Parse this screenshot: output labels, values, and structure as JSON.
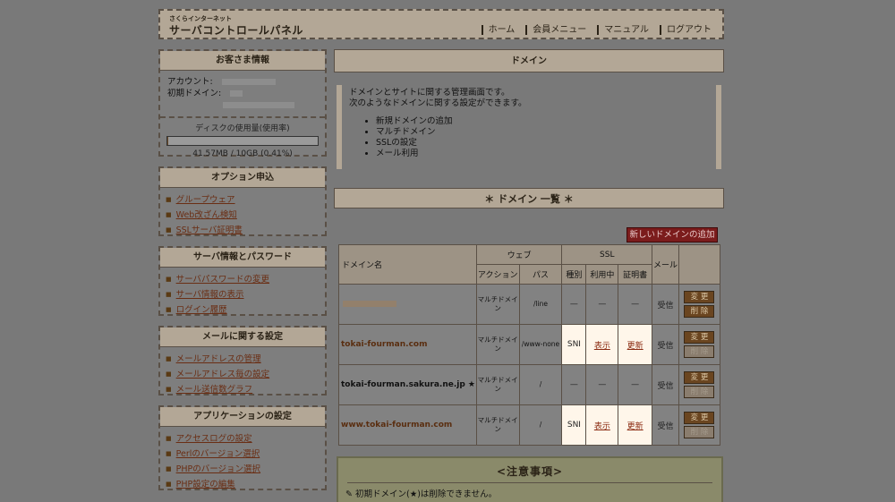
{
  "header": {
    "brand_small": "さくらインターネット",
    "brand_big": "サーバコントロールパネル",
    "nav": [
      "ホーム",
      "会員メニュー",
      "マニュアル",
      "ログアウト"
    ]
  },
  "account": {
    "title": "お客さま情報",
    "account_label": "アカウント:",
    "domain_label": "初期ドメイン:",
    "disk_label": "ディスクの使用量(使用率)",
    "disk_usage": "41.57MB / 10GB (0.41%)",
    "disk_fraction": 0.0041
  },
  "sidebar": [
    {
      "title": "オプション申込",
      "items": [
        "グループウェア",
        "Web改ざん検知",
        "SSLサーバ証明書"
      ]
    },
    {
      "title": "サーバ情報とパスワード",
      "items": [
        "サーバパスワードの変更",
        "サーバ情報の表示",
        "ログイン履歴"
      ]
    },
    {
      "title": "メールに関する設定",
      "items": [
        "メールアドレスの管理",
        "メールアドレス毎の設定",
        "メール送信数グラフ"
      ]
    },
    {
      "title": "アプリケーションの設定",
      "items": [
        "アクセスログの設定",
        "Perlのバージョン選択",
        "PHPのバージョン選択",
        "PHP設定の編集"
      ]
    }
  ],
  "main": {
    "title": "ドメイン",
    "intro_line1": "ドメインとサイトに関する管理画面です。",
    "intro_line2": "次のようなドメインに関する設定ができます。",
    "intro_items": [
      "新規ドメインの追加",
      "マルチドメイン",
      "SSLの設定",
      "メール利用"
    ],
    "list_title": "＊ ドメイン 一覧 ＊",
    "add_button": "新しいドメインの追加"
  },
  "table": {
    "headers": {
      "domain": "ドメイン名",
      "web": "ウェブ",
      "ssl": "SSL",
      "mail": "メール",
      "action": "アクション",
      "path": "パス",
      "kind": "種別",
      "inuse": "利用中",
      "cert": "証明書"
    },
    "rows": [
      {
        "domain": "",
        "action": "マルチドメイン",
        "path": "/line",
        "kind": "—",
        "inuse": "—",
        "cert": "—",
        "mail": "受信",
        "edit": "変 更",
        "delete": "削 除"
      },
      {
        "domain": "tokai-fourman.com",
        "action": "マルチドメイン",
        "path": "/www-none",
        "kind": "SNI",
        "inuse": "表示",
        "cert": "更新",
        "mail": "受信",
        "edit": "変 更",
        "delete": "削 除"
      },
      {
        "domain": "tokai-fourman.sakura.ne.jp ★",
        "action": "マルチドメイン",
        "path": "/",
        "kind": "—",
        "inuse": "—",
        "cert": "—",
        "mail": "受信",
        "edit": "変 更",
        "delete": "削 除"
      },
      {
        "domain": "www.tokai-fourman.com",
        "action": "マルチドメイン",
        "path": "/",
        "kind": "SNI",
        "inuse": "表示",
        "cert": "更新",
        "mail": "受信",
        "edit": "変 更",
        "delete": "削 除"
      }
    ]
  },
  "notes": {
    "title": "<注意事項>",
    "line1": "初期ドメイン(★)は削除できません。"
  }
}
